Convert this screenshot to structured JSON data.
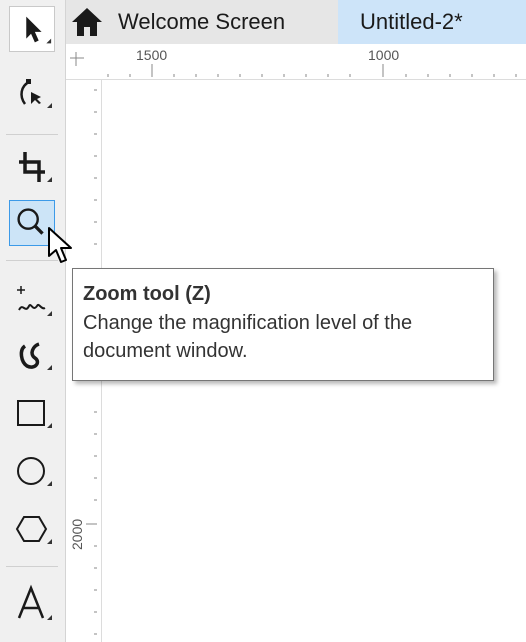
{
  "tabs": {
    "welcome_label": "Welcome Screen",
    "document_label": "Untitled-2*"
  },
  "rulers": {
    "h_labels": [
      "1500",
      "1000"
    ],
    "v_label": "2000"
  },
  "toolbox": {
    "tools": [
      {
        "name": "pick-tool",
        "icon": "arrow-pointer-icon"
      },
      {
        "name": "shape-tool",
        "icon": "shape-node-icon"
      },
      {
        "name": "crop-tool",
        "icon": "crop-icon"
      },
      {
        "name": "zoom-tool",
        "icon": "magnifier-icon",
        "active": true
      },
      {
        "name": "freehand-tool",
        "icon": "freehand-icon"
      },
      {
        "name": "artistic-media-tool",
        "icon": "artistic-media-icon"
      },
      {
        "name": "rectangle-tool",
        "icon": "rectangle-icon"
      },
      {
        "name": "ellipse-tool",
        "icon": "ellipse-icon"
      },
      {
        "name": "polygon-tool",
        "icon": "polygon-icon"
      },
      {
        "name": "text-tool",
        "icon": "text-A-icon"
      }
    ]
  },
  "tooltip": {
    "title": "Zoom tool (Z)",
    "description": "Change the magnification level of the document window."
  },
  "colors": {
    "active_tab": "#cde4f9",
    "active_tool": "#cce4f7",
    "active_tool_border": "#3c9ae8"
  }
}
